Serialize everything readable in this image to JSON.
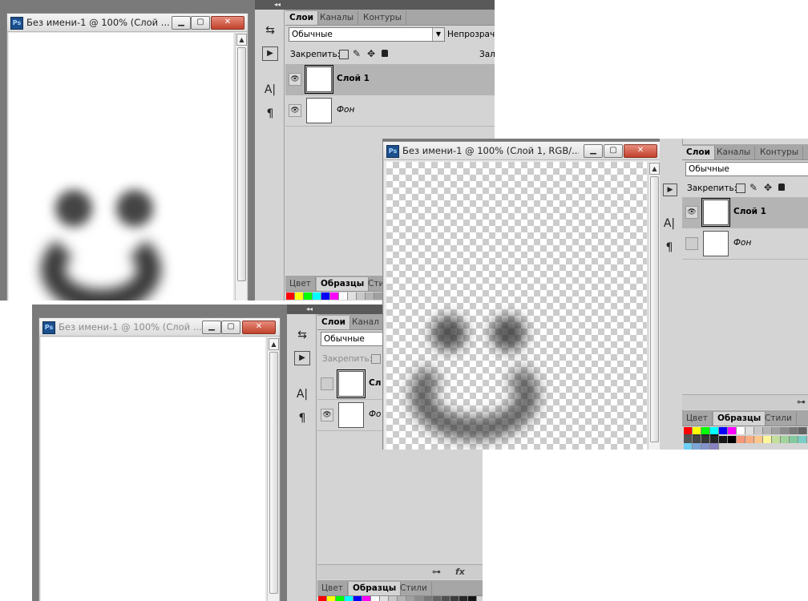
{
  "app": {
    "logo": "Ps"
  },
  "doc_window": {
    "title": "Без имени-1 @ 100% (Слой ...",
    "title_active": "Без имени-1 @ 100% (Слой 1, RGB/...",
    "min": "▁",
    "max": "▢",
    "close": "✕"
  },
  "tools": {
    "text_tool": "A|",
    "paragraph_tool": "¶",
    "swap": "⇆",
    "play": "▶"
  },
  "layers_panel": {
    "tabs": [
      "Слои",
      "Каналы",
      "Контуры"
    ],
    "blend_mode": "Обычные",
    "opacity_label": "Непрозрачн",
    "lock_label": "Закрепить:",
    "fill_label": "Зали",
    "layers": [
      {
        "name": "Слой 1",
        "selected": true
      },
      {
        "name": "Фон",
        "selected": false
      }
    ],
    "layer_short": "Сл",
    "bg_short": "Фо",
    "tab_short": "Канал"
  },
  "swatches_panel": {
    "tabs": [
      "Цвет",
      "Образцы",
      "Стили"
    ],
    "tab_short": "Сти",
    "colors_row1": [
      "#ff0000",
      "#ffff00",
      "#00ff00",
      "#00ffff",
      "#0000ff",
      "#ff00ff",
      "#ffffff",
      "#e0e0e0",
      "#c8c8c8",
      "#b4b4b4",
      "#a0a0a0",
      "#8c8c8c",
      "#787878",
      "#646464",
      "#505050",
      "#3c3c3c",
      "#282828",
      "#141414"
    ],
    "colors_row2": [
      "#545454",
      "#444444",
      "#363636",
      "#262626",
      "#161616",
      "#000000",
      "#f7977a",
      "#f9ad81",
      "#fdc68a",
      "#fff79a",
      "#c4df9b",
      "#a2d39c",
      "#82ca9d",
      "#7bcdc8",
      "#6ecff6",
      "#7ea7d8",
      "#8493ca",
      "#8882be"
    ]
  },
  "icons": [
    "eye-icon",
    "lock-transparency-icon",
    "brush-icon",
    "move-icon",
    "padlock-icon",
    "link-icon",
    "fx-icon"
  ]
}
